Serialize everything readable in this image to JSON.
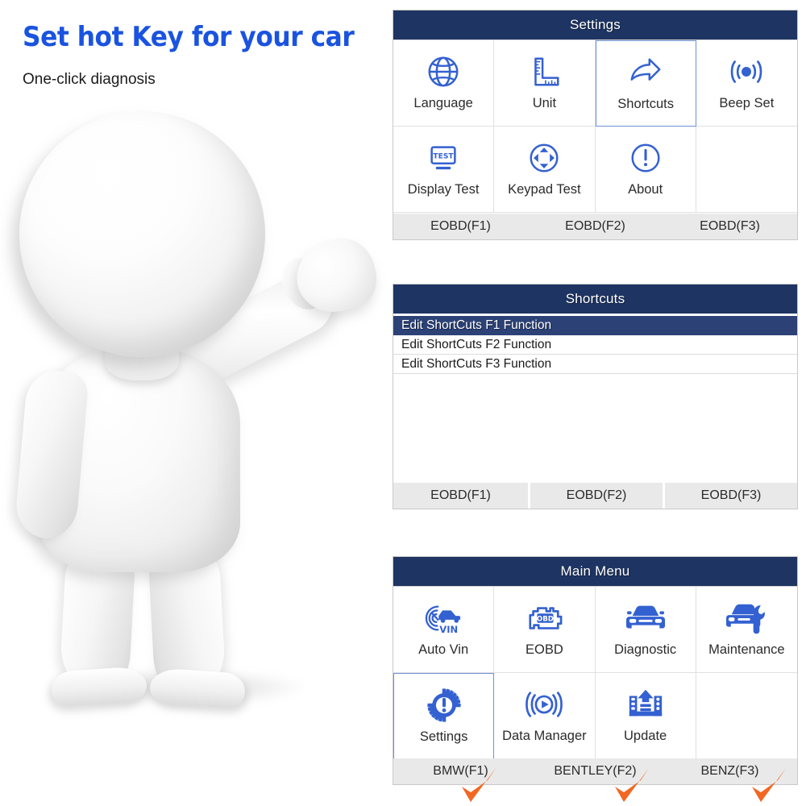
{
  "promo": {
    "title": "Set hot Key for your car",
    "subtitle": "One-click diagnosis",
    "title_color": "#1a53e0",
    "mascot": "3d-white-figure-waving"
  },
  "theme": {
    "header_navy": "#1e3563",
    "selection_navy": "#2c4277",
    "icon_blue": "#3461d1",
    "footer_gray": "#e9e9e9",
    "arrow_orange": "#f26722",
    "focus_border": "#6d92d8"
  },
  "panels": [
    {
      "id": "settings",
      "title": "Settings",
      "type": "icon-grid",
      "cells": [
        {
          "label": "Language",
          "icon": "globe-icon",
          "selected": false
        },
        {
          "label": "Unit",
          "icon": "ruler-icon",
          "selected": false
        },
        {
          "label": "Shortcuts",
          "icon": "share-arrow-icon",
          "selected": true
        },
        {
          "label": "Beep Set",
          "icon": "beep-wave-icon",
          "selected": false
        },
        {
          "label": "Display Test",
          "icon": "monitor-test-icon",
          "selected": false
        },
        {
          "label": "Keypad Test",
          "icon": "dpad-circle-icon",
          "selected": false
        },
        {
          "label": "About",
          "icon": "info-circle-icon",
          "selected": false
        },
        {
          "label": "",
          "icon": "",
          "selected": false
        }
      ],
      "fkeys": [
        "EOBD(F1)",
        "EOBD(F2)",
        "EOBD(F3)"
      ],
      "fkeys_divided": false
    },
    {
      "id": "shortcuts",
      "title": "Shortcuts",
      "type": "list",
      "rows": [
        {
          "label": "Edit ShortCuts F1 Function",
          "selected": true
        },
        {
          "label": "Edit ShortCuts F2 Function",
          "selected": false
        },
        {
          "label": "Edit ShortCuts F3 Function",
          "selected": false
        }
      ],
      "fkeys": [
        "EOBD(F1)",
        "EOBD(F2)",
        "EOBD(F3)"
      ],
      "fkeys_divided": true
    },
    {
      "id": "mainmenu",
      "title": "Main Menu",
      "type": "icon-grid",
      "cells": [
        {
          "label": "Auto Vin",
          "icon": "auto-vin-icon",
          "selected": false
        },
        {
          "label": "EOBD",
          "icon": "obd-engine-icon",
          "selected": false
        },
        {
          "label": "Diagnostic",
          "icon": "car-front-icon",
          "selected": false
        },
        {
          "label": "Maintenance",
          "icon": "car-wrench-icon",
          "selected": false
        },
        {
          "label": "Settings",
          "icon": "gear-alert-icon",
          "selected": true
        },
        {
          "label": "Data Manager",
          "icon": "play-rings-icon",
          "selected": false
        },
        {
          "label": "Update",
          "icon": "upload-film-icon",
          "selected": false
        },
        {
          "label": "",
          "icon": "",
          "selected": false
        }
      ],
      "fkeys": [
        "BMW(F1)",
        "BENTLEY(F2)",
        "BENZ(F3)"
      ],
      "fkeys_divided": false
    }
  ],
  "annotations": {
    "arrows": [
      {
        "name": "check-arrow-f1",
        "points_to": "BMW(F1)"
      },
      {
        "name": "check-arrow-f2",
        "points_to": "BENTLEY(F2)"
      },
      {
        "name": "check-arrow-f3",
        "points_to": "BENZ(F3)"
      }
    ]
  }
}
